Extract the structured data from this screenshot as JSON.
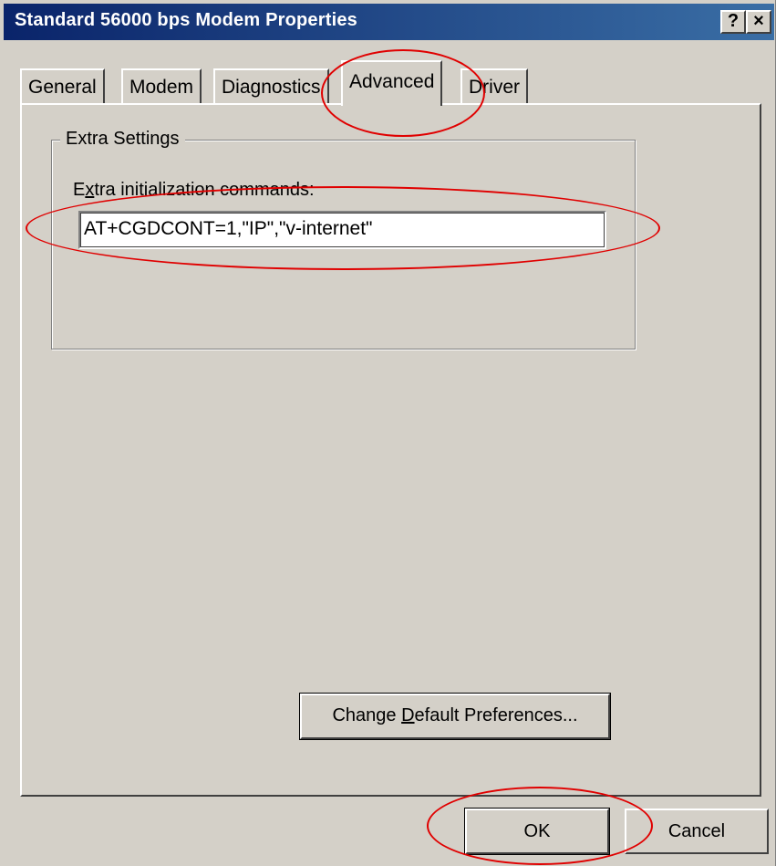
{
  "window": {
    "title": "Standard 56000 bps Modem Properties",
    "help_glyph": "?",
    "close_glyph": "×"
  },
  "tabs": [
    {
      "label": "General",
      "active": false
    },
    {
      "label": "Modem",
      "active": false
    },
    {
      "label": "Diagnostics",
      "active": false
    },
    {
      "label": "Advanced",
      "active": true
    },
    {
      "label": "Driver",
      "active": false
    }
  ],
  "advanced": {
    "group_title": "Extra Settings",
    "field_label": "Extra initialization commands:",
    "field_value": "AT+CGDCONT=1,\"IP\",\"v-internet\"",
    "change_defaults_label": "Change Default Preferences..."
  },
  "footer": {
    "ok_label": "OK",
    "cancel_label": "Cancel"
  },
  "colors": {
    "face": "#d4d0c8",
    "title_start": "#0a246a",
    "title_end": "#3a6ea5",
    "annotation": "#e00000"
  }
}
